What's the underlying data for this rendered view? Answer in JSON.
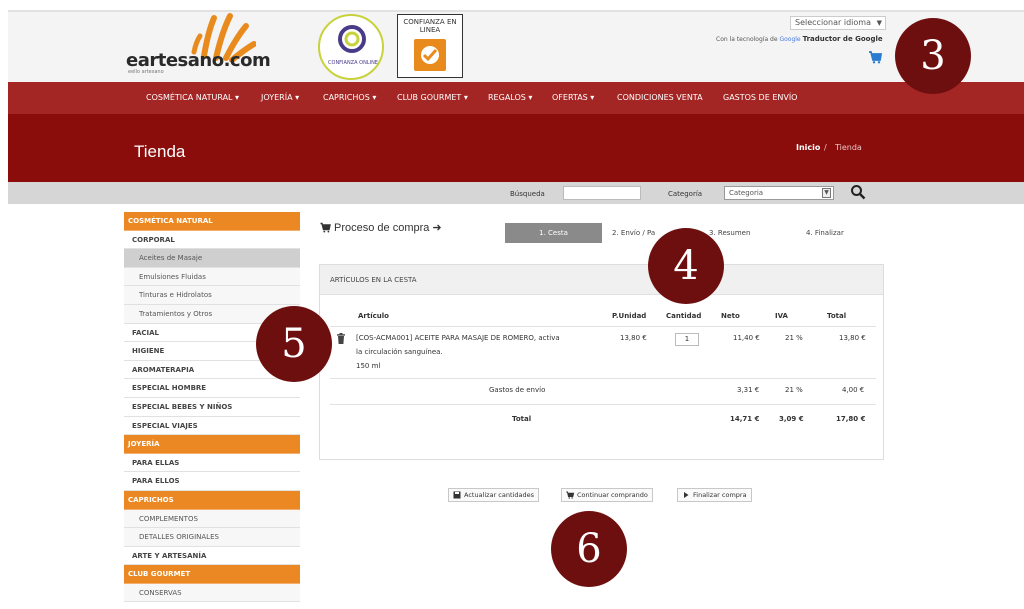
{
  "header": {
    "logo": "eartesano.com",
    "logo_sub": "eello artesano",
    "seal1_text": "CONFIANZA ONLINE",
    "seal2_text": "CONFIANZA EN LINEA",
    "language_select": "Seleccionar idioma",
    "google_prefix": "Con la tecnología de",
    "google_brand": "Google",
    "google_suffix": "Traductor de Google"
  },
  "nav": {
    "items": [
      "COSMÉTICA NATURAL ▾",
      "JOYERÍA ▾",
      "CAPRICHOS ▾",
      "CLUB GOURMET ▾",
      "REGALOS ▾",
      "OFERTAS ▾",
      "CONDICIONES VENTA",
      "GASTOS DE ENVÍO"
    ]
  },
  "banner": {
    "title": "Tienda",
    "breadcrumb_home": "Inicio",
    "breadcrumb_sep": "/",
    "breadcrumb_current": "Tienda"
  },
  "search": {
    "label": "Búsqueda",
    "category_label": "Categoría",
    "category_value": "Categoria"
  },
  "sidebar": {
    "items": [
      {
        "label": "COSMÉTICA NATURAL",
        "type": "cat"
      },
      {
        "label": "CORPORAL",
        "type": "l1"
      },
      {
        "label": "Aceites de Masaje",
        "type": "l2 active"
      },
      {
        "label": "Emulsiones Fluidas",
        "type": "l2"
      },
      {
        "label": "Tinturas e Hidrolatos",
        "type": "l2"
      },
      {
        "label": "Tratamientos y Otros",
        "type": "l2"
      },
      {
        "label": "FACIAL",
        "type": "l1"
      },
      {
        "label": "HIGIENE",
        "type": "l1"
      },
      {
        "label": "AROMATERAPIA",
        "type": "l1"
      },
      {
        "label": "ESPECIAL HOMBRE",
        "type": "l1"
      },
      {
        "label": "ESPECIAL BEBES Y NIÑOS",
        "type": "l1"
      },
      {
        "label": "ESPECIAL VIAJES",
        "type": "l1"
      },
      {
        "label": "JOYERÍA",
        "type": "cat"
      },
      {
        "label": "PARA ELLAS",
        "type": "l1"
      },
      {
        "label": "PARA ELLOS",
        "type": "l1"
      },
      {
        "label": "CAPRICHOS",
        "type": "cat"
      },
      {
        "label": "COMPLEMENTOS",
        "type": "l2"
      },
      {
        "label": "DETALLES ORIGINALES",
        "type": "l2"
      },
      {
        "label": "ARTE Y ARTESANÍA",
        "type": "l1"
      },
      {
        "label": "CLUB GOURMET",
        "type": "cat"
      },
      {
        "label": "CONSERVAS",
        "type": "l2"
      }
    ]
  },
  "process": {
    "title": "Proceso de compra ➜",
    "steps": [
      "1. Cesta",
      "2. Envío / Pa",
      "3. Resumen",
      "4. Finalizar"
    ]
  },
  "cart": {
    "heading": "ARTÍCULOS EN LA CESTA",
    "columns": [
      "Artículo",
      "P.Unidad",
      "Cantidad",
      "Neto",
      "IVA",
      "Total"
    ],
    "item": {
      "line1": "[COS-ACMA001] ACEITE PARA MASAJE DE ROMERO, activa",
      "line2": "la circulación sanguínea.",
      "line3": "150 ml",
      "unit_price": "13,80 €",
      "quantity": "1",
      "net": "11,40 €",
      "vat": "21 %",
      "total": "13,80 €"
    },
    "shipping": {
      "label": "Gastos de envío",
      "net": "3,31 €",
      "vat": "21 %",
      "total": "4,00 €"
    },
    "totals": {
      "label": "Total",
      "net": "14,71 €",
      "vat": "3,09 €",
      "total": "17,80 €"
    }
  },
  "buttons": {
    "update": "Actualizar cantidades",
    "continue": "Continuar comprando",
    "finish": "Finalizar compra"
  },
  "markers": [
    "3",
    "4",
    "5",
    "6"
  ],
  "colors": {
    "nav_bg": "#a32524",
    "banner_bg": "#8a0c0b",
    "sidebar_category": "#ec8823",
    "marker": "#6e0f0f"
  }
}
